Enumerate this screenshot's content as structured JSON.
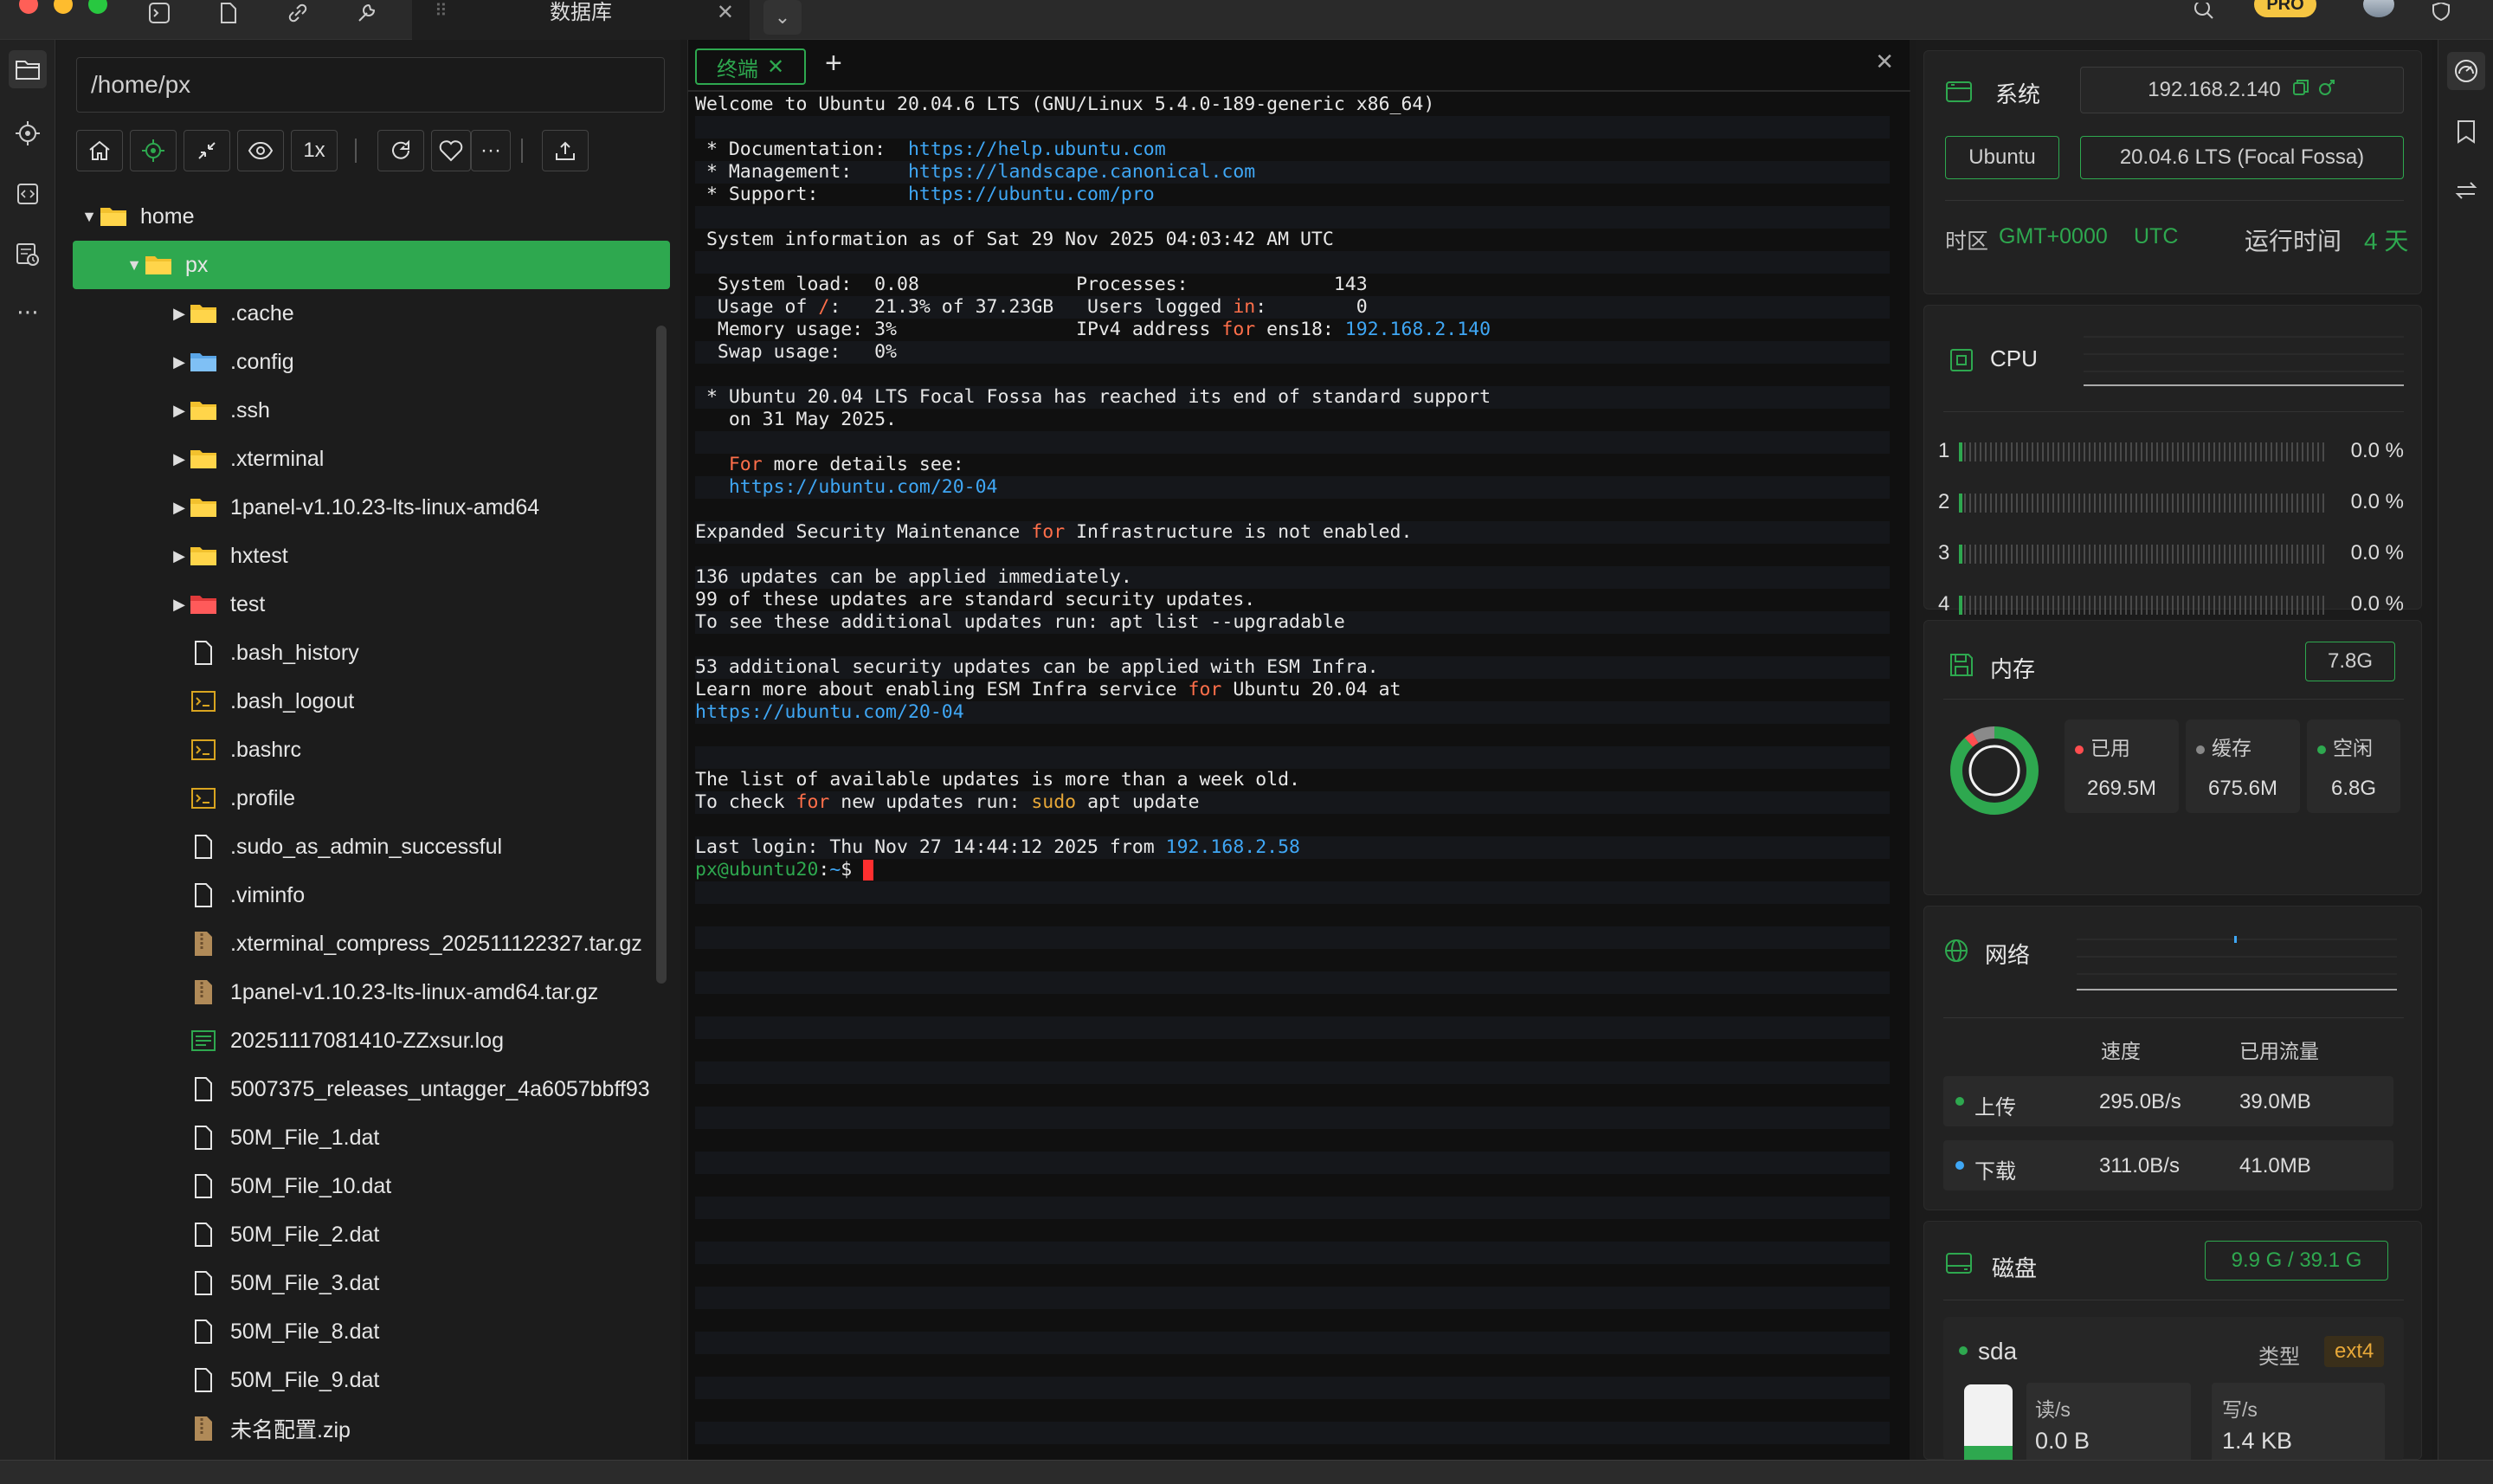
{
  "window": {
    "db_tab_label": "数据库",
    "close_glyph": "✕",
    "more_glyph": "⌄"
  },
  "badges": {
    "pro": "PRO"
  },
  "files": {
    "path": "/home/px",
    "zoom_label": "1x",
    "more_glyph": "···",
    "tree": [
      {
        "name": "home",
        "depth": 0,
        "type": "folder",
        "expanded": true
      },
      {
        "name": "px",
        "depth": 1,
        "type": "folder",
        "expanded": true,
        "selected": true
      },
      {
        "name": ".cache",
        "depth": 2,
        "type": "folder"
      },
      {
        "name": ".config",
        "depth": 2,
        "type": "folder-config"
      },
      {
        "name": ".ssh",
        "depth": 2,
        "type": "folder"
      },
      {
        "name": ".xterminal",
        "depth": 2,
        "type": "folder"
      },
      {
        "name": "1panel-v1.10.23-lts-linux-amd64",
        "depth": 2,
        "type": "folder"
      },
      {
        "name": "hxtest",
        "depth": 2,
        "type": "folder"
      },
      {
        "name": "test",
        "depth": 2,
        "type": "folder-red"
      },
      {
        "name": ".bash_history",
        "depth": 2,
        "type": "file"
      },
      {
        "name": ".bash_logout",
        "depth": 2,
        "type": "shell"
      },
      {
        "name": ".bashrc",
        "depth": 2,
        "type": "shell"
      },
      {
        "name": ".profile",
        "depth": 2,
        "type": "shell"
      },
      {
        "name": ".sudo_as_admin_successful",
        "depth": 2,
        "type": "file"
      },
      {
        "name": ".viminfo",
        "depth": 2,
        "type": "file"
      },
      {
        "name": ".xterminal_compress_202511122327.tar.gz",
        "depth": 2,
        "type": "archive"
      },
      {
        "name": "1panel-v1.10.23-lts-linux-amd64.tar.gz",
        "depth": 2,
        "type": "archive"
      },
      {
        "name": "20251117081410-ZZxsur.log",
        "depth": 2,
        "type": "log"
      },
      {
        "name": "5007375_releases_untagger_4a6057bbff93",
        "depth": 2,
        "type": "file"
      },
      {
        "name": "50M_File_1.dat",
        "depth": 2,
        "type": "file"
      },
      {
        "name": "50M_File_10.dat",
        "depth": 2,
        "type": "file"
      },
      {
        "name": "50M_File_2.dat",
        "depth": 2,
        "type": "file"
      },
      {
        "name": "50M_File_3.dat",
        "depth": 2,
        "type": "file"
      },
      {
        "name": "50M_File_8.dat",
        "depth": 2,
        "type": "file"
      },
      {
        "name": "50M_File_9.dat",
        "depth": 2,
        "type": "file"
      },
      {
        "name": "未名配置.zip",
        "depth": 2,
        "type": "archive"
      }
    ]
  },
  "terminal": {
    "tab_label": "终端",
    "tab_close": "✕",
    "add_glyph": "+",
    "close_glyph": "✕",
    "lines": [
      [
        {
          "t": "Welcome to Ubuntu 20.04.6 LTS (GNU/Linux 5.4.0-189-generic x86_64)"
        }
      ],
      [
        {
          "t": ""
        }
      ],
      [
        {
          "t": " * Documentation:  "
        },
        {
          "t": "https://help.ubuntu.com",
          "c": "lnk"
        }
      ],
      [
        {
          "t": " * Management:     "
        },
        {
          "t": "https://landscape.canonical.com",
          "c": "lnk"
        }
      ],
      [
        {
          "t": " * Support:        "
        },
        {
          "t": "https://ubuntu.com/pro",
          "c": "lnk"
        }
      ],
      [
        {
          "t": ""
        }
      ],
      [
        {
          "t": " System information as of Sat 29 Nov 2025 04:03:42 AM UTC"
        }
      ],
      [
        {
          "t": ""
        }
      ],
      [
        {
          "t": "  System load:  0.08              Processes:             143"
        }
      ],
      [
        {
          "t": "  Usage of "
        },
        {
          "t": "/",
          "c": "kw"
        },
        {
          "t": ":   21.3% of 37.23GB   Users logged "
        },
        {
          "t": "in",
          "c": "kw"
        },
        {
          "t": ":        0"
        }
      ],
      [
        {
          "t": "  Memory usage: 3%                IPv4 address "
        },
        {
          "t": "for",
          "c": "kw"
        },
        {
          "t": " ens18: "
        },
        {
          "t": "192.168.2.140",
          "c": "ip"
        }
      ],
      [
        {
          "t": "  Swap usage:   0%"
        }
      ],
      [
        {
          "t": ""
        }
      ],
      [
        {
          "t": " * Ubuntu 20.04 LTS Focal Fossa has reached its end of standard support"
        }
      ],
      [
        {
          "t": "   on 31 May 2025."
        }
      ],
      [
        {
          "t": ""
        }
      ],
      [
        {
          "t": "   "
        },
        {
          "t": "For",
          "c": "kw"
        },
        {
          "t": " more details see:"
        }
      ],
      [
        {
          "t": "   "
        },
        {
          "t": "https://ubuntu.com/20-04",
          "c": "lnk"
        }
      ],
      [
        {
          "t": ""
        }
      ],
      [
        {
          "t": "Expanded Security Maintenance "
        },
        {
          "t": "for",
          "c": "kw"
        },
        {
          "t": " Infrastructure is not enabled."
        }
      ],
      [
        {
          "t": ""
        }
      ],
      [
        {
          "t": "136 updates can be applied immediately."
        }
      ],
      [
        {
          "t": "99 of these updates are standard security updates."
        }
      ],
      [
        {
          "t": "To see these additional updates run: apt list --upgradable"
        }
      ],
      [
        {
          "t": ""
        }
      ],
      [
        {
          "t": "53 additional security updates can be applied with ESM Infra."
        }
      ],
      [
        {
          "t": "Learn more about enabling ESM Infra service "
        },
        {
          "t": "for",
          "c": "kw"
        },
        {
          "t": " Ubuntu 20.04 at"
        }
      ],
      [
        {
          "t": "https://ubuntu.com/20-04",
          "c": "lnk"
        }
      ],
      [
        {
          "t": ""
        }
      ],
      [
        {
          "t": ""
        }
      ],
      [
        {
          "t": "The list of available updates is more than a week old."
        }
      ],
      [
        {
          "t": "To check "
        },
        {
          "t": "for",
          "c": "kw"
        },
        {
          "t": " new updates run: "
        },
        {
          "t": "sudo",
          "c": "sudo"
        },
        {
          "t": " apt update"
        }
      ],
      [
        {
          "t": ""
        }
      ],
      [
        {
          "t": "Last login: Thu Nov 27 14:44:12 2025 from "
        },
        {
          "t": "192.168.2.58",
          "c": "ip"
        }
      ],
      [
        {
          "t": "px@ubuntu20",
          "c": "prompt"
        },
        {
          "t": ":"
        },
        {
          "t": "~",
          "c": "lnk"
        },
        {
          "t": "$ "
        }
      ]
    ]
  },
  "system": {
    "title": "系统",
    "ip": "192.168.2.140",
    "os": "Ubuntu",
    "version": "20.04.6 LTS (Focal Fossa)",
    "tz_label": "时区",
    "tz_offset": "GMT+0000",
    "tz_name": "UTC",
    "uptime_label": "运行时间",
    "uptime_value": "4 天"
  },
  "cpu": {
    "title": "CPU",
    "cores": [
      {
        "id": "1",
        "value": "0.0 %"
      },
      {
        "id": "2",
        "value": "0.0 %"
      },
      {
        "id": "3",
        "value": "0.0 %"
      },
      {
        "id": "4",
        "value": "0.0 %"
      }
    ]
  },
  "memory": {
    "title": "内存",
    "total": "7.8G",
    "used_label": "已用",
    "used": "269.5M",
    "cache_label": "缓存",
    "cache": "675.6M",
    "free_label": "空闲",
    "free": "6.8G",
    "used_fraction": 0.034,
    "cache_fraction": 0.085
  },
  "network": {
    "title": "网络",
    "speed_header": "速度",
    "traffic_header": "已用流量",
    "up_label": "上传",
    "up_speed": "295.0B/s",
    "up_total": "39.0MB",
    "down_label": "下载",
    "down_speed": "311.0B/s",
    "down_total": "41.0MB"
  },
  "disk": {
    "title": "磁盘",
    "usage": "9.9 G / 39.1 G",
    "device": "sda",
    "type_label": "类型",
    "type": "ext4",
    "read_label": "读/s",
    "read": "0.0 B",
    "write_label": "写/s",
    "write": "1.4 KB",
    "used_fraction": 0.25
  },
  "colors": {
    "accent": "#2ea84f",
    "link": "#3fa7f5",
    "keyword": "#ff6f4a",
    "cursor": "#ff2f2f"
  }
}
